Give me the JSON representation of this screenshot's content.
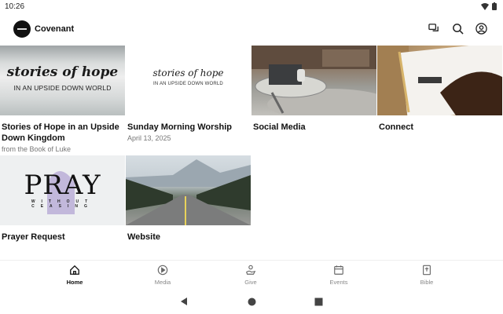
{
  "status": {
    "time": "10:26"
  },
  "app": {
    "name": "Covenant"
  },
  "tiles": [
    {
      "title": "Stories of Hope in an Upside Down Kingdom",
      "subtitle": "from the Book of Luke",
      "art_script": "stories of hope",
      "art_sub": "IN AN UPSIDE DOWN WORLD"
    },
    {
      "title": "Sunday Morning Worship",
      "subtitle": "April 13, 2025",
      "art_script": "stories of hope",
      "art_sub": "IN AN UPSIDE DOWN WORLD"
    },
    {
      "title": "Social Media"
    },
    {
      "title": "Connect"
    },
    {
      "title": "Prayer Request",
      "art_word": "PRAY",
      "art_sub": "WITHOUT CEASING"
    },
    {
      "title": "Website"
    }
  ],
  "nav": [
    {
      "label": "Home",
      "icon": "home-icon",
      "active": true
    },
    {
      "label": "Media",
      "icon": "play-icon",
      "active": false
    },
    {
      "label": "Give",
      "icon": "give-icon",
      "active": false
    },
    {
      "label": "Events",
      "icon": "calendar-icon",
      "active": false
    },
    {
      "label": "Bible",
      "icon": "bible-icon",
      "active": false
    }
  ]
}
